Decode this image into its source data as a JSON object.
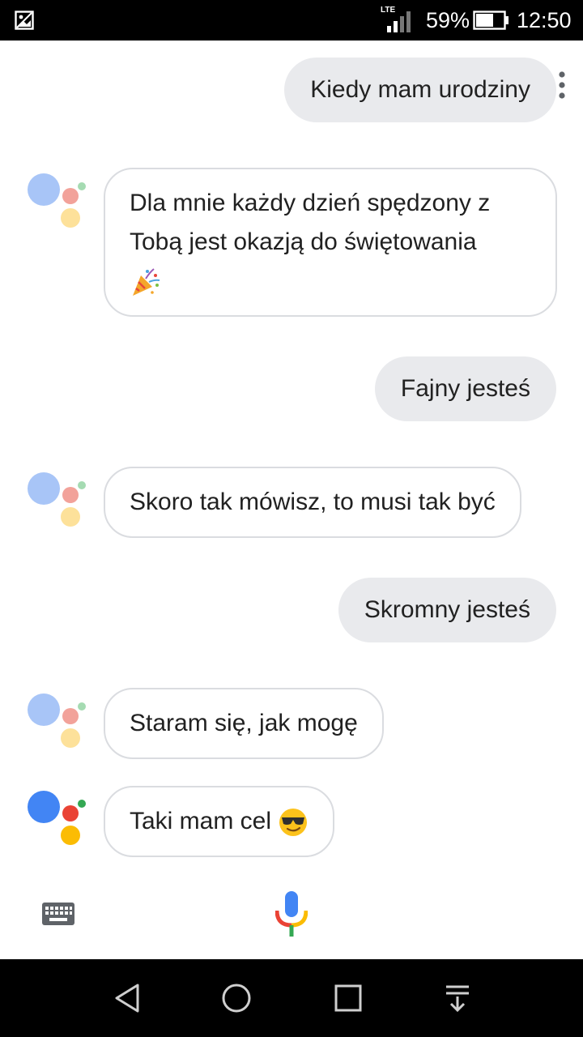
{
  "status_bar": {
    "network": "LTE",
    "battery": "59%",
    "time": "12:50"
  },
  "conversation": [
    {
      "role": "user",
      "text": "Kiedy mam urodziny"
    },
    {
      "role": "assistant",
      "text_line1": "Dla mnie każdy dzień spędzony z",
      "text_line2": "Tobą jest okazją do świętowania",
      "emoji": "party-popper-icon"
    },
    {
      "role": "user",
      "text": "Fajny jesteś"
    },
    {
      "role": "assistant",
      "text": "Skoro tak mówisz, to musi tak być"
    },
    {
      "role": "user",
      "text": "Skromny jesteś"
    },
    {
      "role": "assistant",
      "text": "Staram się, jak mogę"
    },
    {
      "role": "assistant",
      "text": "Taki mam cel",
      "emoji": "sunglasses-smile-icon"
    }
  ],
  "input_bar": {
    "left_icon": "keyboard-icon",
    "center_icon": "mic-icon"
  },
  "navigation": [
    "back-icon",
    "home-icon",
    "recents-icon",
    "notification-pull-icon"
  ],
  "colors": {
    "user_bubble": "#e9eaed",
    "assistant_border": "#dadce0",
    "google_blue": "#4285f4",
    "google_red": "#ea4335",
    "google_yellow": "#fbbc04",
    "google_green": "#34a853"
  }
}
